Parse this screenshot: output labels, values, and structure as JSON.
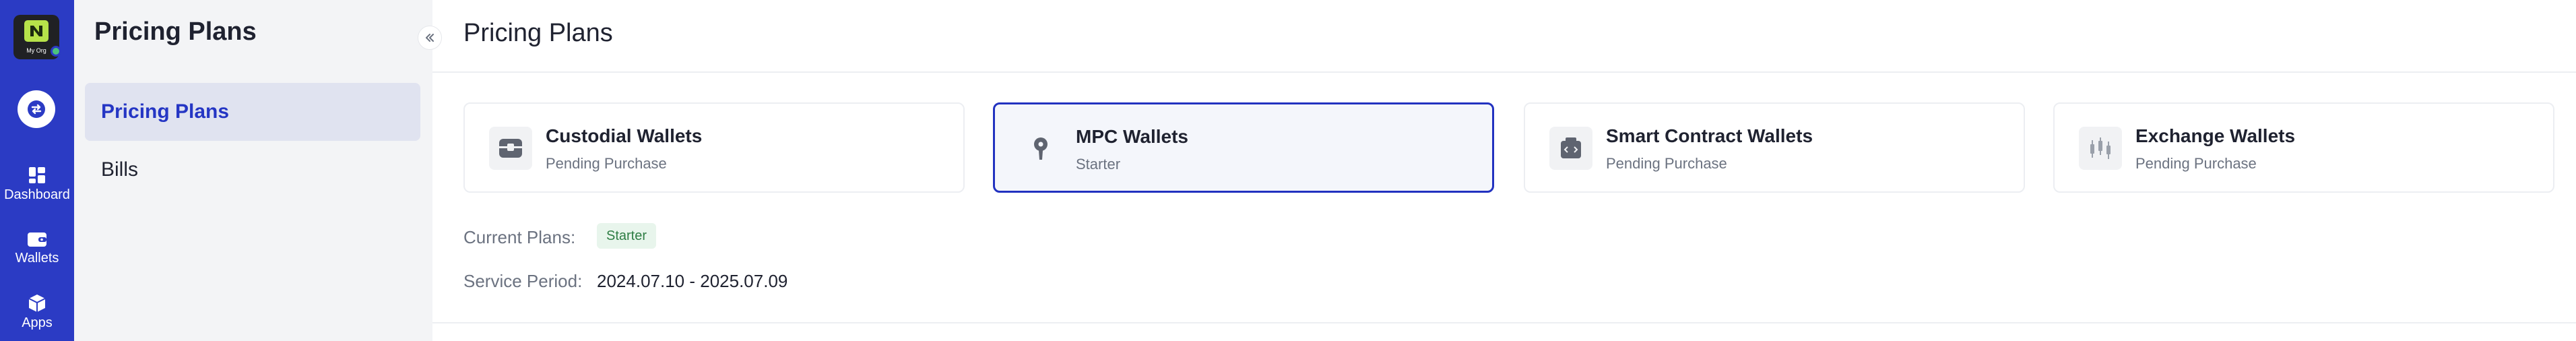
{
  "rail": {
    "logo_text": "My Org",
    "items": [
      {
        "label": "Dashboard",
        "icon": "dashboard-icon"
      },
      {
        "label": "Wallets",
        "icon": "wallet-icon"
      },
      {
        "label": "Apps",
        "icon": "apps-icon"
      }
    ]
  },
  "sidebar": {
    "title": "Pricing Plans",
    "items": [
      {
        "label": "Pricing Plans",
        "active": true
      },
      {
        "label": "Bills",
        "active": false
      }
    ],
    "collapse_icon": "chevrons-left-icon"
  },
  "header": {
    "title": "Pricing Plans"
  },
  "cards": [
    {
      "name": "Custodial Wallets",
      "status": "Pending Purchase",
      "icon": "vault-icon",
      "selected": false
    },
    {
      "name": "MPC Wallets",
      "status": "Starter",
      "icon": "key-icon",
      "selected": true
    },
    {
      "name": "Smart Contract Wallets",
      "status": "Pending Purchase",
      "icon": "contract-icon",
      "selected": false
    },
    {
      "name": "Exchange Wallets",
      "status": "Pending Purchase",
      "icon": "exchange-chart-icon",
      "selected": false
    }
  ],
  "plan": {
    "current_label": "Current Plans:",
    "current_value": "Starter",
    "period_label": "Service Period:",
    "period_value": "2024.07.10 - 2025.07.09"
  },
  "colors": {
    "rail": "#2b3bc4",
    "accent": "#2232c0",
    "badge_bg": "#e8f5ec",
    "badge_text": "#2e7d44"
  }
}
